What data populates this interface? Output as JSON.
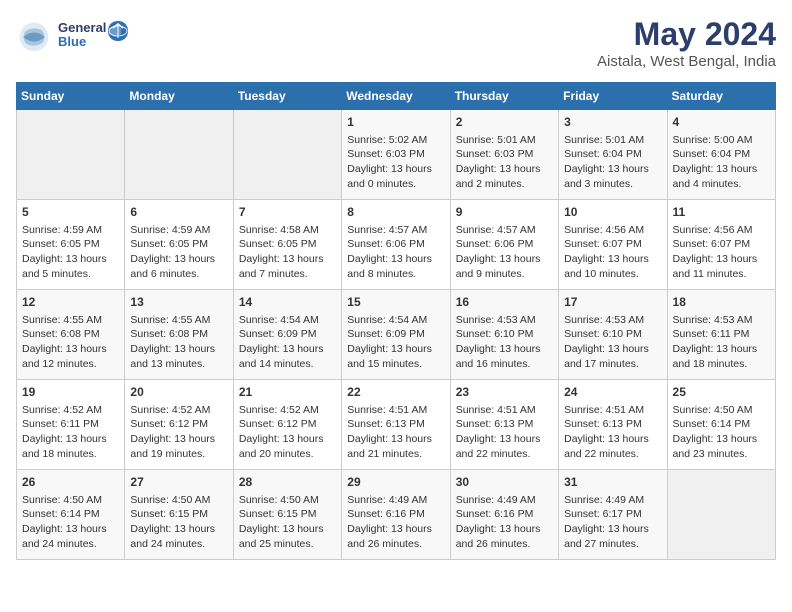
{
  "logo": {
    "line1": "General",
    "line2": "Blue"
  },
  "title": "May 2024",
  "subtitle": "Aistala, West Bengal, India",
  "days_of_week": [
    "Sunday",
    "Monday",
    "Tuesday",
    "Wednesday",
    "Thursday",
    "Friday",
    "Saturday"
  ],
  "weeks": [
    [
      {
        "day": "",
        "info": ""
      },
      {
        "day": "",
        "info": ""
      },
      {
        "day": "",
        "info": ""
      },
      {
        "day": "1",
        "info": "Sunrise: 5:02 AM\nSunset: 6:03 PM\nDaylight: 13 hours\nand 0 minutes."
      },
      {
        "day": "2",
        "info": "Sunrise: 5:01 AM\nSunset: 6:03 PM\nDaylight: 13 hours\nand 2 minutes."
      },
      {
        "day": "3",
        "info": "Sunrise: 5:01 AM\nSunset: 6:04 PM\nDaylight: 13 hours\nand 3 minutes."
      },
      {
        "day": "4",
        "info": "Sunrise: 5:00 AM\nSunset: 6:04 PM\nDaylight: 13 hours\nand 4 minutes."
      }
    ],
    [
      {
        "day": "5",
        "info": "Sunrise: 4:59 AM\nSunset: 6:05 PM\nDaylight: 13 hours\nand 5 minutes."
      },
      {
        "day": "6",
        "info": "Sunrise: 4:59 AM\nSunset: 6:05 PM\nDaylight: 13 hours\nand 6 minutes."
      },
      {
        "day": "7",
        "info": "Sunrise: 4:58 AM\nSunset: 6:05 PM\nDaylight: 13 hours\nand 7 minutes."
      },
      {
        "day": "8",
        "info": "Sunrise: 4:57 AM\nSunset: 6:06 PM\nDaylight: 13 hours\nand 8 minutes."
      },
      {
        "day": "9",
        "info": "Sunrise: 4:57 AM\nSunset: 6:06 PM\nDaylight: 13 hours\nand 9 minutes."
      },
      {
        "day": "10",
        "info": "Sunrise: 4:56 AM\nSunset: 6:07 PM\nDaylight: 13 hours\nand 10 minutes."
      },
      {
        "day": "11",
        "info": "Sunrise: 4:56 AM\nSunset: 6:07 PM\nDaylight: 13 hours\nand 11 minutes."
      }
    ],
    [
      {
        "day": "12",
        "info": "Sunrise: 4:55 AM\nSunset: 6:08 PM\nDaylight: 13 hours\nand 12 minutes."
      },
      {
        "day": "13",
        "info": "Sunrise: 4:55 AM\nSunset: 6:08 PM\nDaylight: 13 hours\nand 13 minutes."
      },
      {
        "day": "14",
        "info": "Sunrise: 4:54 AM\nSunset: 6:09 PM\nDaylight: 13 hours\nand 14 minutes."
      },
      {
        "day": "15",
        "info": "Sunrise: 4:54 AM\nSunset: 6:09 PM\nDaylight: 13 hours\nand 15 minutes."
      },
      {
        "day": "16",
        "info": "Sunrise: 4:53 AM\nSunset: 6:10 PM\nDaylight: 13 hours\nand 16 minutes."
      },
      {
        "day": "17",
        "info": "Sunrise: 4:53 AM\nSunset: 6:10 PM\nDaylight: 13 hours\nand 17 minutes."
      },
      {
        "day": "18",
        "info": "Sunrise: 4:53 AM\nSunset: 6:11 PM\nDaylight: 13 hours\nand 18 minutes."
      }
    ],
    [
      {
        "day": "19",
        "info": "Sunrise: 4:52 AM\nSunset: 6:11 PM\nDaylight: 13 hours\nand 18 minutes."
      },
      {
        "day": "20",
        "info": "Sunrise: 4:52 AM\nSunset: 6:12 PM\nDaylight: 13 hours\nand 19 minutes."
      },
      {
        "day": "21",
        "info": "Sunrise: 4:52 AM\nSunset: 6:12 PM\nDaylight: 13 hours\nand 20 minutes."
      },
      {
        "day": "22",
        "info": "Sunrise: 4:51 AM\nSunset: 6:13 PM\nDaylight: 13 hours\nand 21 minutes."
      },
      {
        "day": "23",
        "info": "Sunrise: 4:51 AM\nSunset: 6:13 PM\nDaylight: 13 hours\nand 22 minutes."
      },
      {
        "day": "24",
        "info": "Sunrise: 4:51 AM\nSunset: 6:13 PM\nDaylight: 13 hours\nand 22 minutes."
      },
      {
        "day": "25",
        "info": "Sunrise: 4:50 AM\nSunset: 6:14 PM\nDaylight: 13 hours\nand 23 minutes."
      }
    ],
    [
      {
        "day": "26",
        "info": "Sunrise: 4:50 AM\nSunset: 6:14 PM\nDaylight: 13 hours\nand 24 minutes."
      },
      {
        "day": "27",
        "info": "Sunrise: 4:50 AM\nSunset: 6:15 PM\nDaylight: 13 hours\nand 24 minutes."
      },
      {
        "day": "28",
        "info": "Sunrise: 4:50 AM\nSunset: 6:15 PM\nDaylight: 13 hours\nand 25 minutes."
      },
      {
        "day": "29",
        "info": "Sunrise: 4:49 AM\nSunset: 6:16 PM\nDaylight: 13 hours\nand 26 minutes."
      },
      {
        "day": "30",
        "info": "Sunrise: 4:49 AM\nSunset: 6:16 PM\nDaylight: 13 hours\nand 26 minutes."
      },
      {
        "day": "31",
        "info": "Sunrise: 4:49 AM\nSunset: 6:17 PM\nDaylight: 13 hours\nand 27 minutes."
      },
      {
        "day": "",
        "info": ""
      }
    ]
  ]
}
